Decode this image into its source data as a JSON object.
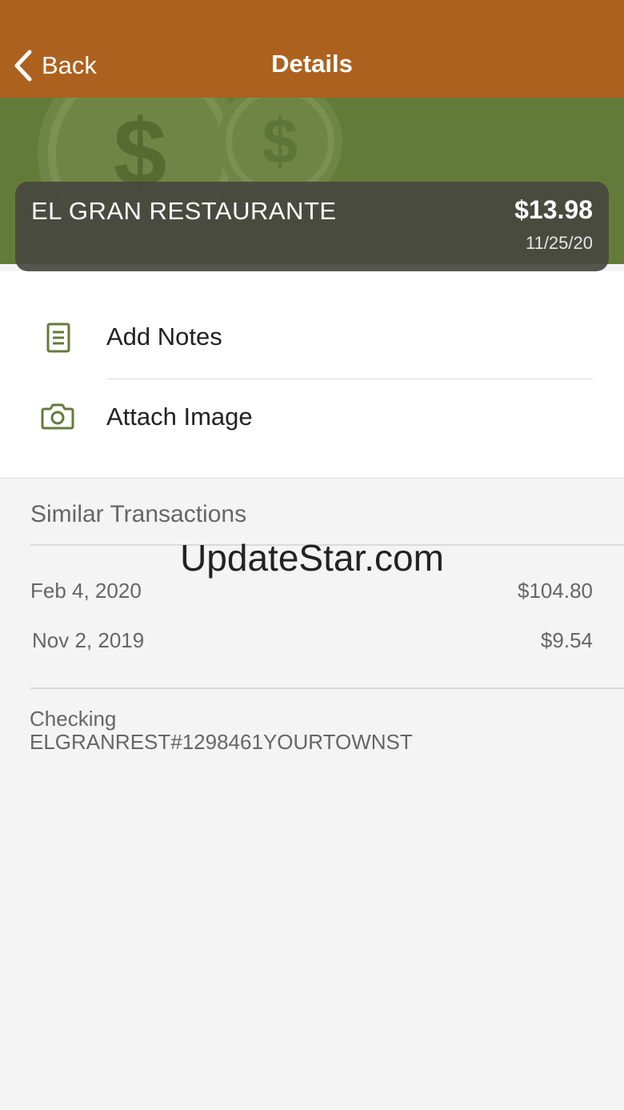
{
  "nav": {
    "back_label": "Back",
    "title": "Details",
    "bar_color": "#ad611e"
  },
  "banner": {
    "color": "#637b39",
    "decor_icon": "dollar-coin-icon"
  },
  "transaction": {
    "merchant": "EL GRAN RESTAURANTE",
    "amount": "$13.98",
    "date": "11/25/20"
  },
  "actions": [
    {
      "label": "Add Notes",
      "icon": "notes-icon"
    },
    {
      "label": "Attach Image",
      "icon": "camera-icon"
    }
  ],
  "similar": {
    "title": "Similar Transactions",
    "items": [
      {
        "date": "Feb 4, 2020",
        "amount": "$104.80"
      },
      {
        "date": "Nov 2, 2019",
        "amount": "$9.54"
      }
    ]
  },
  "watermark": "UpdateStar.com",
  "account": {
    "type": "Checking",
    "description": "ELGRANREST#1298461YOURTOWNST"
  },
  "accent_color": "#637b39"
}
